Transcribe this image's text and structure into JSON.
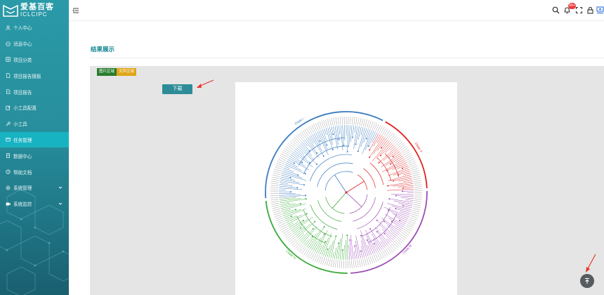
{
  "logo": {
    "name_cn": "爱基百客",
    "name_en": "ICLCIPC"
  },
  "sidebar": {
    "items": [
      {
        "label": "个人中心",
        "icon": "user-icon"
      },
      {
        "label": "消息中心",
        "icon": "message-icon"
      },
      {
        "label": "项目分类",
        "icon": "grid-icon"
      },
      {
        "label": "项目报告模板",
        "icon": "file-icon"
      },
      {
        "label": "项目报告",
        "icon": "file-icon"
      },
      {
        "label": "小工具配置",
        "icon": "edit-icon"
      },
      {
        "label": "小工具",
        "icon": "wrench-icon"
      },
      {
        "label": "任务管理",
        "icon": "task-icon",
        "active": true
      },
      {
        "label": "数据中心",
        "icon": "document-icon"
      },
      {
        "label": "帮助文档",
        "icon": "help-icon"
      },
      {
        "label": "系统管理",
        "icon": "gear-icon",
        "expandable": true
      },
      {
        "label": "系统监控",
        "icon": "monitor-icon",
        "expandable": true
      }
    ]
  },
  "topbar": {
    "icons": [
      "search-icon",
      "bell-icon",
      "fullscreen-icon",
      "lock-icon",
      "user-profile-icon"
    ],
    "notification_count": "99+"
  },
  "main": {
    "section_title": "结果展示",
    "tabs": {
      "image": "图片区域",
      "file": "文件区域"
    },
    "download_label": "下载"
  },
  "tree": {
    "clade_labels": [
      "Clade I",
      "Clade II",
      "Clade III",
      "Clade IV"
    ]
  },
  "colors": {
    "accent": "#11838f",
    "sidebar": "#2a9aa8",
    "sidebar_active": "#18b3c2",
    "clade_blue": "#3a7bbf",
    "clade_red": "#e02020",
    "clade_purple": "#9b4db5",
    "clade_green": "#3aaa3a"
  }
}
